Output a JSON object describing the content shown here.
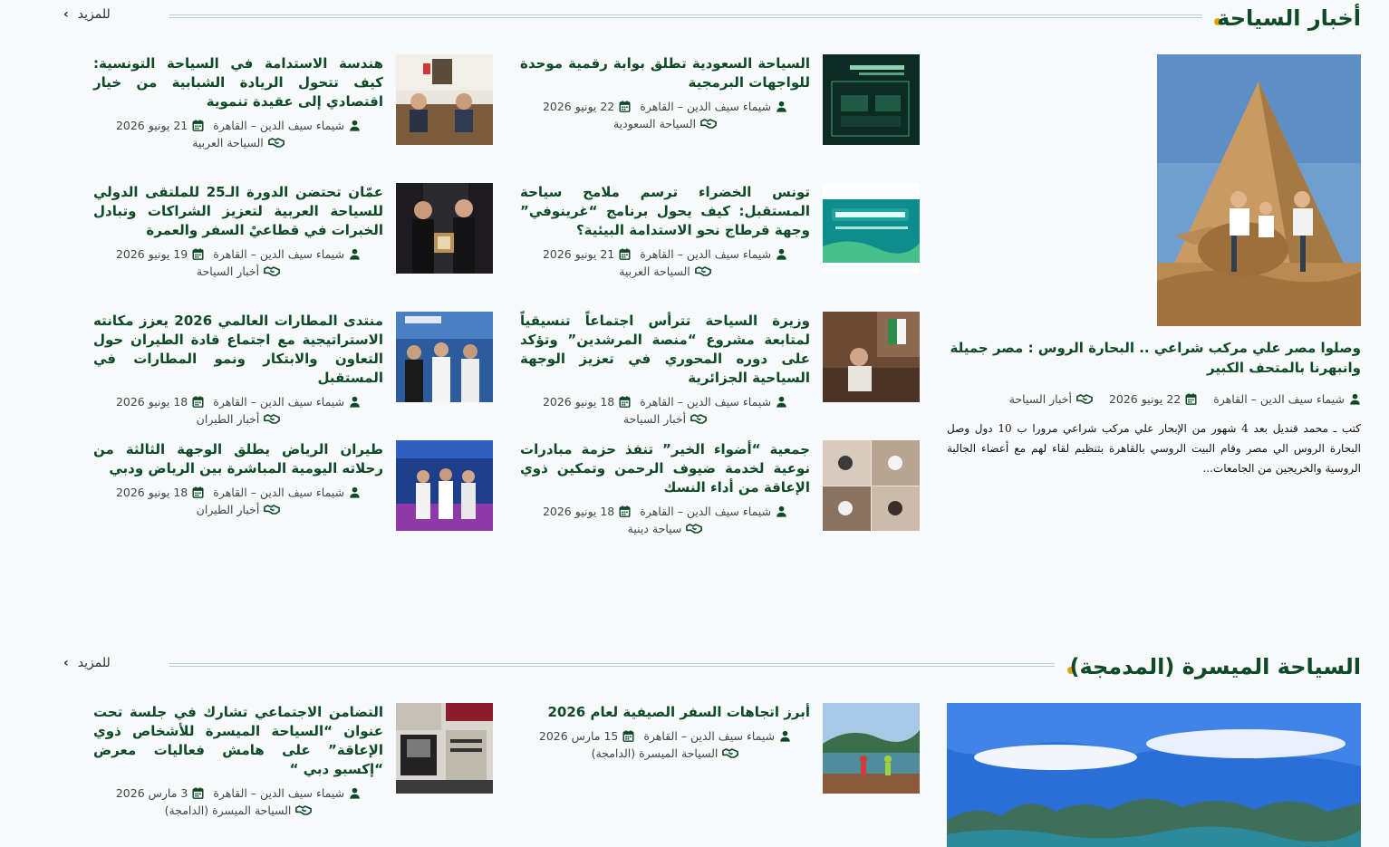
{
  "colors": {
    "accent": "#e0a800",
    "title": "#0d4a25",
    "line": "#b9cfc3",
    "background": "#f7f9fb"
  },
  "icons": {
    "author": "user-icon",
    "date": "calendar-icon",
    "category": "handshake-icon",
    "more": "chevron-left-icon"
  },
  "section1": {
    "title": "أخبار السياحة",
    "more_label": "للمزيد",
    "featured": {
      "title": "وصلوا مصر علي مركب شراعي .. البحارة الروس : مصر جميلة وانبهرنا بالمتحف الكبير",
      "author": "شيماء سيف الدين – القاهرة",
      "date": "22 يونيو 2026",
      "category": "أخبار السياحة",
      "excerpt": "كتب ـ محمد قنديل بعد 4 شهور من الإبحار علي مركب شراعي مرورا ب 10 دول وصل البحارة الروس الي مصر وقام البيت الروسي بالقاهرة بتنظيم لقاء لهم مع أعضاء الجالية الروسية والخريجين من الجامعات..."
    },
    "articles": [
      {
        "title": "السياحة السعودية تطلق بوابة رقمية موحدة للواجهات البرمجية",
        "author": "شيماء سيف الدين – القاهرة",
        "date": "22 يونيو 2026",
        "category": "السياحة السعودية"
      },
      {
        "title": "هندسة الاستدامة في السياحة التونسية: كيف تتحول الريادة الشبابية من خيار اقتصادي إلى عقيدة تنموية",
        "author": "شيماء سيف الدين – القاهرة",
        "date": "21 يونيو 2026",
        "category": "السياحة العربية"
      },
      {
        "title": "تونس الخضراء ترسم ملامح سياحة المستقبل: كيف يحول برنامج “غرينوفي” وجهة قرطاج نحو الاستدامة البيئية؟",
        "author": "شيماء سيف الدين – القاهرة",
        "date": "21 يونيو 2026",
        "category": "السياحة العربية"
      },
      {
        "title": "عمّان تحتضن الدورة الـ25 للملتقى الدولي للسياحة العربية لتعزيز الشراكات وتبادل الخبرات في قطاعيْ السفر والعمرة",
        "author": "شيماء سيف الدين – القاهرة",
        "date": "19 يونيو 2026",
        "category": "أخبار السياحة"
      },
      {
        "title": "وزيرة السياحة تترأس اجتماعاً تنسيقياً لمتابعة مشروع “منصة المرشدين” وتؤكد على دوره المحوري في تعزيز الوجهة السياحية الجزائرية",
        "author": "شيماء سيف الدين – القاهرة",
        "date": "18 يونيو 2026",
        "category": "أخبار السياحة"
      },
      {
        "title": "منتدى المطارات العالمي 2026 يعزز مكانته الاستراتيجية مع اجتماع قادة الطيران حول التعاون والابتكار ونمو المطارات في المستقبل",
        "author": "شيماء سيف الدين – القاهرة",
        "date": "18 يونيو 2026",
        "category": "أخبار الطيران"
      },
      {
        "title": "جمعية “أضواء الخير” تنفذ حزمة مبادرات نوعية لخدمة ضيوف الرحمن وتمكين ذوي الإعاقة من أداء النسك",
        "author": "شيماء سيف الدين – القاهرة",
        "date": "18 يونيو 2026",
        "category": "سياحة دينية"
      },
      {
        "title": "طيران الرياض يطلق الوجهة الثالثة من رحلاته اليومية المباشرة بين الرياض ودبي",
        "author": "شيماء سيف الدين – القاهرة",
        "date": "18 يونيو 2026",
        "category": "أخبار الطيران"
      }
    ]
  },
  "section2": {
    "title": "السياحة الميسرة (المدمجة)",
    "more_label": "للمزيد",
    "articles": [
      {
        "title": "أبرز اتجاهات السفر الصيفية لعام 2026",
        "author": "شيماء سيف الدين – القاهرة",
        "date": "15 مارس 2026",
        "category": "السياحة الميسرة (الدامجة)"
      },
      {
        "title": "التضامن الاجتماعي تشارك في جلسة تحت عنوان “السياحة الميسرة للأشخاص ذوي الإعاقة” على هامش فعاليات معرض “إكسبو دبي “",
        "author": "شيماء سيف الدين – القاهرة",
        "date": "3 مارس 2026",
        "category": "السياحة الميسرة (الدامجة)"
      }
    ]
  }
}
